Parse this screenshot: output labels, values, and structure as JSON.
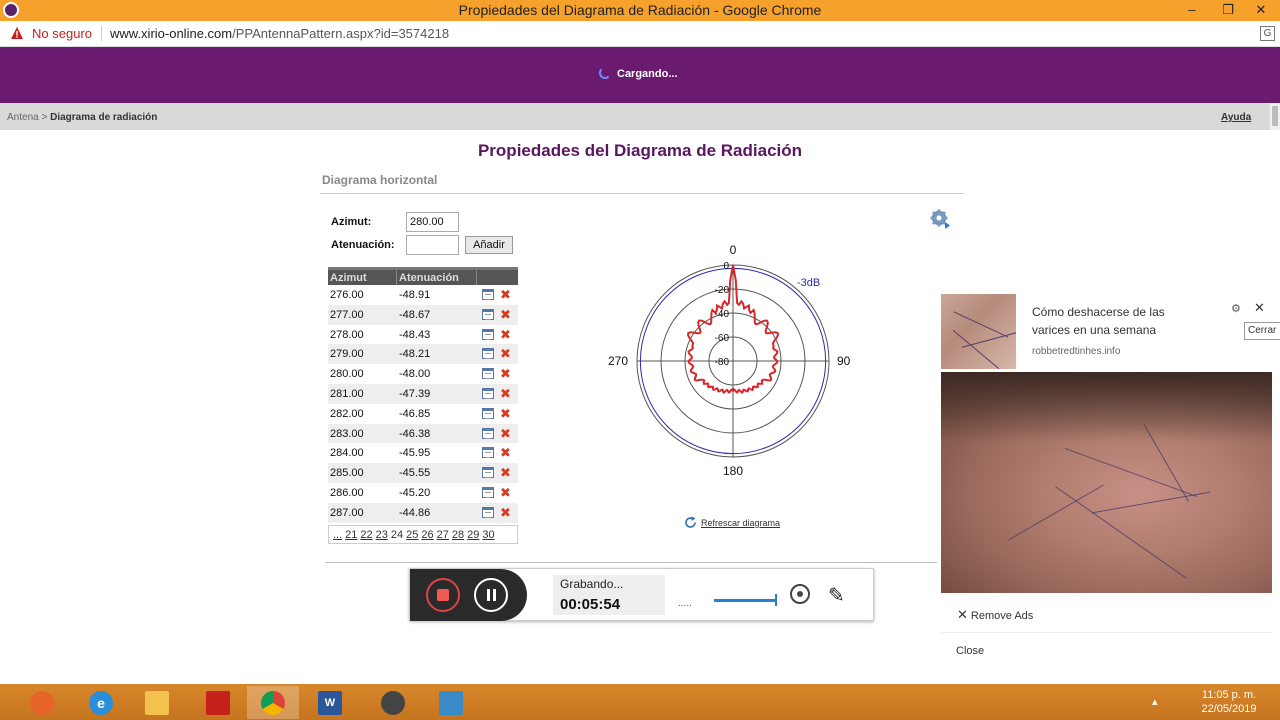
{
  "window": {
    "title": "Propiedades del Diagrama de Radiación - Google Chrome",
    "minimize_glyph": "–",
    "restore_glyph": "❐",
    "close_glyph": "✕"
  },
  "address_bar": {
    "security_text": "No seguro",
    "url_host": "www.xirio-online.com",
    "url_path": "/PPAntennaPattern.aspx?id=3574218"
  },
  "header": {
    "loading_text": "Cargando..."
  },
  "breadcrumb": {
    "parent": "Antena",
    "separator": ">",
    "current": "Diagrama de radiación",
    "help_label": "Ayuda"
  },
  "main": {
    "title": "Propiedades del Diagrama de Radiación",
    "section_title": "Diagrama horizontal",
    "azimuth_label": "Azimut:",
    "azimuth_value": "280.00",
    "attenuation_label": "Atenuación:",
    "attenuation_value": "",
    "add_button": "Añadir",
    "table": {
      "columns": [
        "Azimut",
        "Atenuación"
      ],
      "rows": [
        [
          "276.00",
          "-48.91"
        ],
        [
          "277.00",
          "-48.67"
        ],
        [
          "278.00",
          "-48.43"
        ],
        [
          "279.00",
          "-48.21"
        ],
        [
          "280.00",
          "-48.00"
        ],
        [
          "281.00",
          "-47.39"
        ],
        [
          "282.00",
          "-46.85"
        ],
        [
          "283.00",
          "-46.38"
        ],
        [
          "284.00",
          "-45.95"
        ],
        [
          "285.00",
          "-45.55"
        ],
        [
          "286.00",
          "-45.20"
        ],
        [
          "287.00",
          "-44.86"
        ]
      ]
    },
    "pagination": [
      "...",
      "21",
      "22",
      "23",
      "24",
      "25",
      "26",
      "27",
      "28",
      "29",
      "30"
    ],
    "current_page": "24",
    "refresh_label": "Refrescar diagrama"
  },
  "polar_chart": {
    "angle_labels": {
      "top": "0",
      "right": "90",
      "bottom": "180",
      "left": "270"
    },
    "ring_labels": [
      "0",
      "-20",
      "-40",
      "-60",
      "-80"
    ],
    "reference_label": "-3dB",
    "pattern_color": "#d9262a",
    "reference_color": "#2a2ab0"
  },
  "recorder": {
    "status": "Grabando...",
    "elapsed": "00:05:54",
    "dots": ".....",
    "stop_icon": "stop-record-icon",
    "pause_icon": "pause-icon",
    "webcam_icon": "webcam-icon",
    "pen_icon": "pen-icon"
  },
  "ad": {
    "headline": "Cómo deshacerse de las varices en una semana",
    "source": "robbetredtinhes.info",
    "close_tooltip": "Cerrar",
    "remove_ads": "Remove Ads",
    "close_label": "Close"
  },
  "taskbar": {
    "apps": [
      "firefox-icon",
      "internet-explorer-icon",
      "file-explorer-icon",
      "acrobat-icon",
      "chrome-icon",
      "word-icon",
      "recorder-pro-icon",
      "image-viewer-icon"
    ],
    "tray_chevron": "▴",
    "time": "11:05 p. m.",
    "date": "22/05/2019"
  }
}
